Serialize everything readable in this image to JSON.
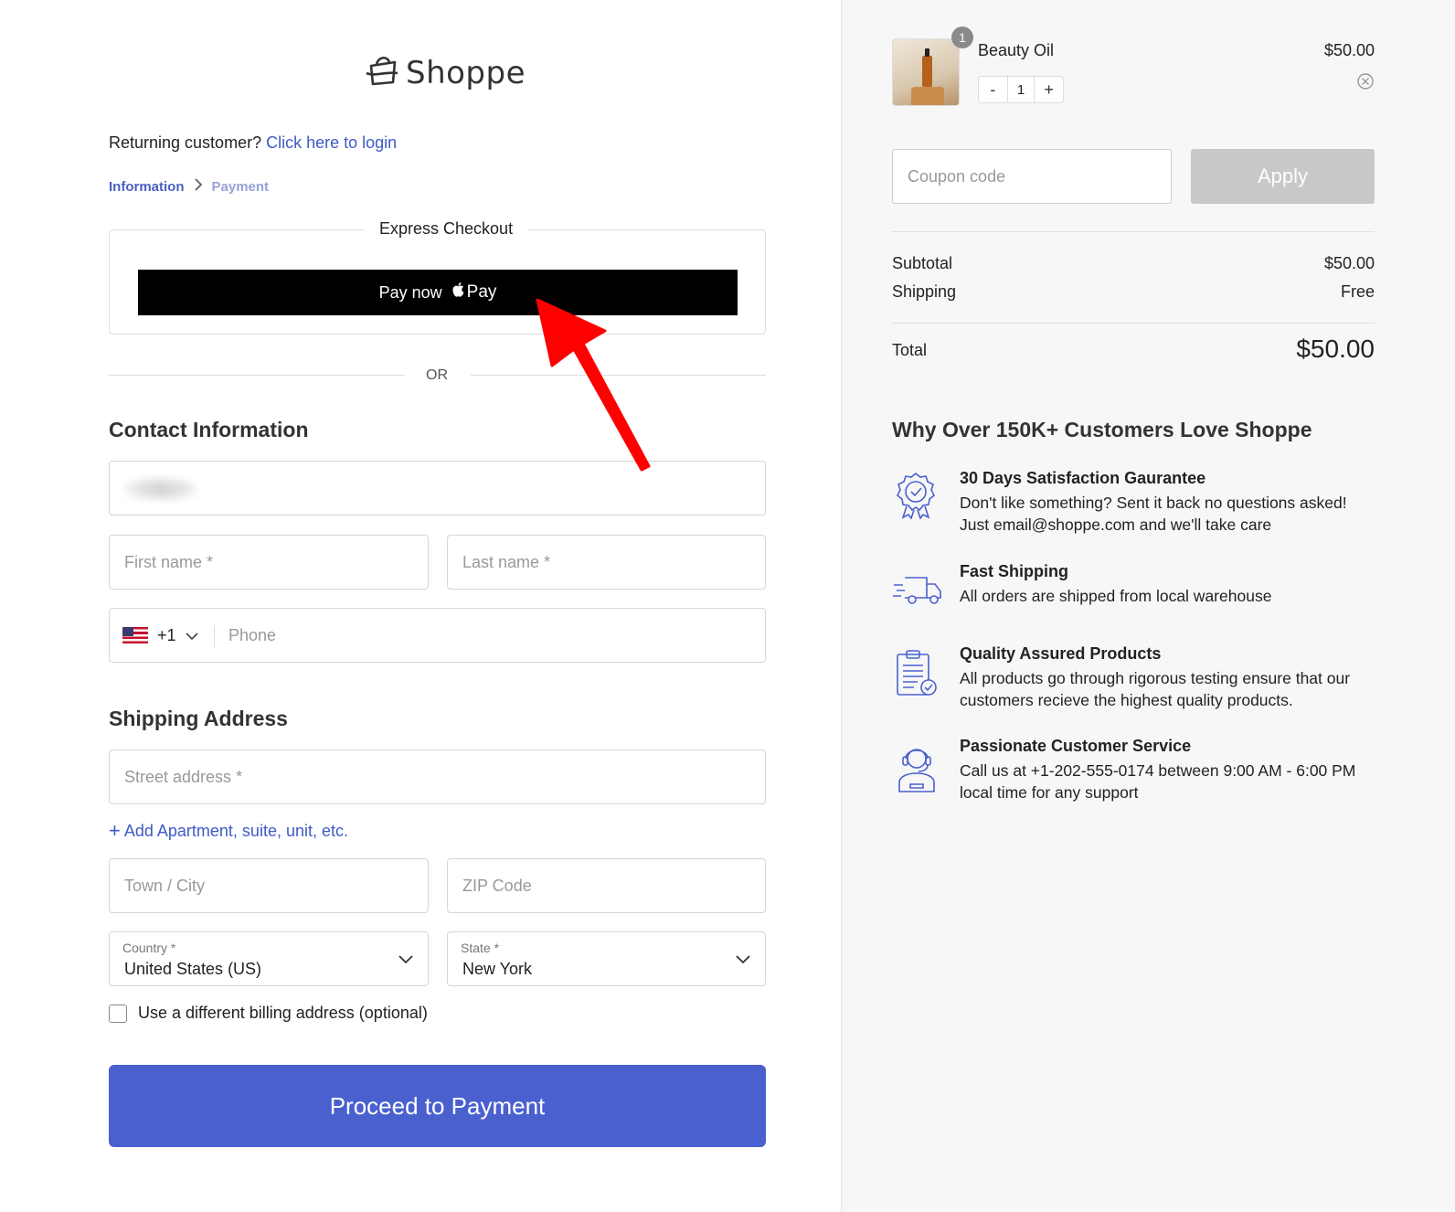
{
  "brand": {
    "name": "Shoppe"
  },
  "returning": {
    "prompt": "Returning customer?",
    "link": "Click here to login"
  },
  "breadcrumb": {
    "step1": "Information",
    "step2": "Payment"
  },
  "express": {
    "title": "Express Checkout",
    "paynow_label": "Pay now",
    "apple_pay_label": "Pay"
  },
  "or_label": "OR",
  "contact": {
    "title": "Contact Information",
    "first_name_placeholder": "First name *",
    "last_name_placeholder": "Last name *",
    "phone_code": "+1",
    "phone_placeholder": "Phone"
  },
  "shipping": {
    "title": "Shipping Address",
    "street_placeholder": "Street address *",
    "add_apartment": "Add Apartment, suite, unit, etc.",
    "city_placeholder": "Town / City",
    "zip_placeholder": "ZIP Code",
    "country_label": "Country *",
    "country_value": "United States (US)",
    "state_label": "State *",
    "state_value": "New York",
    "billing_checkbox_label": "Use a different billing address (optional)"
  },
  "proceed_label": "Proceed to Payment",
  "cart": {
    "item": {
      "name": "Beauty Oil",
      "price": "$50.00",
      "quantity": "1",
      "badge": "1",
      "minus": "-",
      "plus": "+"
    },
    "coupon_placeholder": "Coupon code",
    "apply_label": "Apply",
    "subtotal_label": "Subtotal",
    "subtotal_value": "$50.00",
    "shipping_label": "Shipping",
    "shipping_value": "Free",
    "total_label": "Total",
    "total_value": "$50.00"
  },
  "why": {
    "title": "Why Over 150K+ Customers Love Shoppe",
    "features": [
      {
        "title": "30 Days Satisfaction Gaurantee",
        "line1": "Don't like something? Sent it back no questions asked!",
        "line2": "Just email@shoppe.com and we'll take care",
        "icon": "badge-check-icon"
      },
      {
        "title": "Fast Shipping",
        "line1": "All orders are shipped from local warehouse",
        "line2": "",
        "icon": "delivery-truck-icon"
      },
      {
        "title": "Quality Assured Products",
        "line1": "All products go through rigorous testing ensure that our",
        "line2": "customers recieve the highest quality products.",
        "icon": "clipboard-check-icon"
      },
      {
        "title": "Passionate Customer Service",
        "line1": "Call us at +1-202-555-0174 between 9:00 AM - 6:00 PM",
        "line2": "local time for any support",
        "icon": "support-agent-icon"
      }
    ]
  },
  "colors": {
    "accent": "#4a60cf",
    "link": "#3d5bc4",
    "annotation_arrow": "#ff0000"
  }
}
